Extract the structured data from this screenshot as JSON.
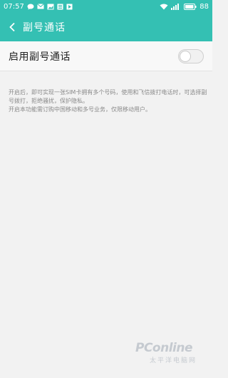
{
  "status_bar": {
    "time": "07:57",
    "battery": "88",
    "left_icons": [
      "chat-bubble-icon",
      "mail-icon",
      "image-icon",
      "news-icon",
      "play-icon"
    ],
    "right_icons": [
      "wifi-icon",
      "signal-icon",
      "battery-icon"
    ]
  },
  "header": {
    "title": "副号通话",
    "back_icon": "chevron-left-icon"
  },
  "setting": {
    "label": "启用副号通话",
    "toggle_on": false
  },
  "description": {
    "line1": "开启后，即可实现一张SIM卡拥有多个号码，使用和飞信拨打电话时，可选择副号拨打，拒绝骚扰，保护隐私。",
    "line2": "开启本功能需订购中国移动和多号业务，仅限移动用户。"
  },
  "watermark": {
    "main": "PConline",
    "sub": "太平洋电脑网"
  },
  "colors": {
    "accent": "#34c0b3",
    "background": "#f2f2f2",
    "text": "#222222",
    "subtext": "#8a8a8a"
  }
}
